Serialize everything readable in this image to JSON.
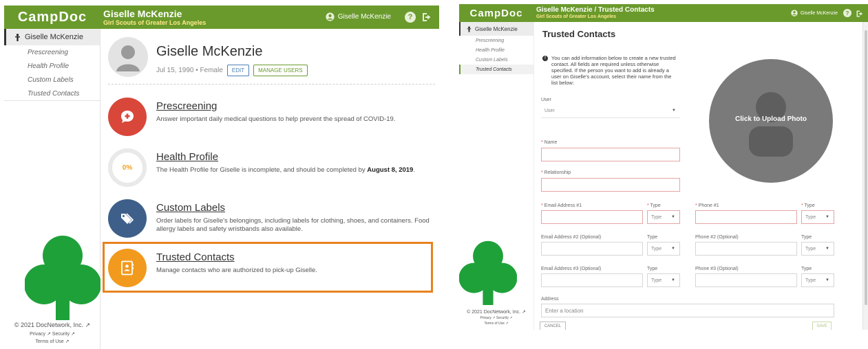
{
  "left": {
    "brand": "CampDoc",
    "header": {
      "name": "Giselle McKenzie",
      "org": "Girl Scouts of Greater Los Angeles",
      "user": "Giselle McKenzie"
    },
    "sidebar": {
      "active": "Giselle McKenzie",
      "items": [
        "Prescreening",
        "Health Profile",
        "Custom Labels",
        "Trusted Contacts"
      ]
    },
    "footer": {
      "copyright": "© 2021 DocNetwork, Inc. ↗",
      "links": "Privacy ↗    Security ↗",
      "terms": "Terms of Use ↗"
    },
    "profile": {
      "name": "Giselle McKenzie",
      "meta": "Jul 15, 1990 • Female",
      "edit": "EDIT",
      "manage": "MANAGE USERS"
    },
    "items": [
      {
        "title": "Prescreening",
        "desc": "Answer important daily medical questions to help prevent the spread of COVID-19.",
        "color": "#d9473b"
      },
      {
        "title": "Health Profile",
        "desc_pre": "The Health Profile for Giselle is incomplete, and should be completed by ",
        "desc_bold": "August 8, 2019",
        "desc_post": ".",
        "percent": "0%"
      },
      {
        "title": "Custom Labels",
        "desc": "Order labels for Giselle's belongings, including labels for clothing, shoes, and containers. Food allergy labels and safety wristbands also available.",
        "color": "#3e5f8a"
      },
      {
        "title": "Trusted Contacts",
        "desc": "Manage contacts who are authorized to pick-up Giselle.",
        "color": "#f29a1e"
      }
    ],
    "highlight_color": "#e8821e"
  },
  "right": {
    "brand": "CampDoc",
    "header": {
      "name": "Giselle McKenzie / Trusted Contacts",
      "org": "Girl Scouts of Greater Los Angeles",
      "user": "Giselle McKenzie"
    },
    "sidebar": {
      "active": "Giselle McKenzie",
      "items": [
        "Prescreening",
        "Health Profile",
        "Custom Labels",
        "Trusted Contacts"
      ]
    },
    "footer": {
      "copyright": "© 2021 DocNetwork, Inc. ↗",
      "links": "Privacy ↗   Security ↗",
      "terms": "Terms of Use ↗"
    },
    "form": {
      "title": "Trusted Contacts",
      "info": "You can add information below to create a new trusted contact. All fields are required unless otherwise specified. If the person you want to add is already a user on Giselle's account, select their name from the list below:",
      "user_label": "User",
      "user_value": "User",
      "name_label": "Name",
      "relationship_label": "Relationship",
      "email1_label": "Email Address #1",
      "type_label": "Type",
      "phone1_label": "Phone #1",
      "email2_label": "Email Address #2 (Optional)",
      "phone2_label": "Phone #2 (Optional)",
      "email3_label": "Email Address #3 (Optional)",
      "phone3_label": "Phone #3 (Optional)",
      "type_value": "Type",
      "address_label": "Address",
      "address_placeholder": "Enter a location",
      "photo_text": "Click to Upload Photo",
      "cancel": "CANCEL",
      "save": "SAVE"
    }
  },
  "colors": {
    "header_green": "#6a9a2c",
    "org_yellow": "#ffe98a",
    "clover_green": "#1fa13a"
  }
}
